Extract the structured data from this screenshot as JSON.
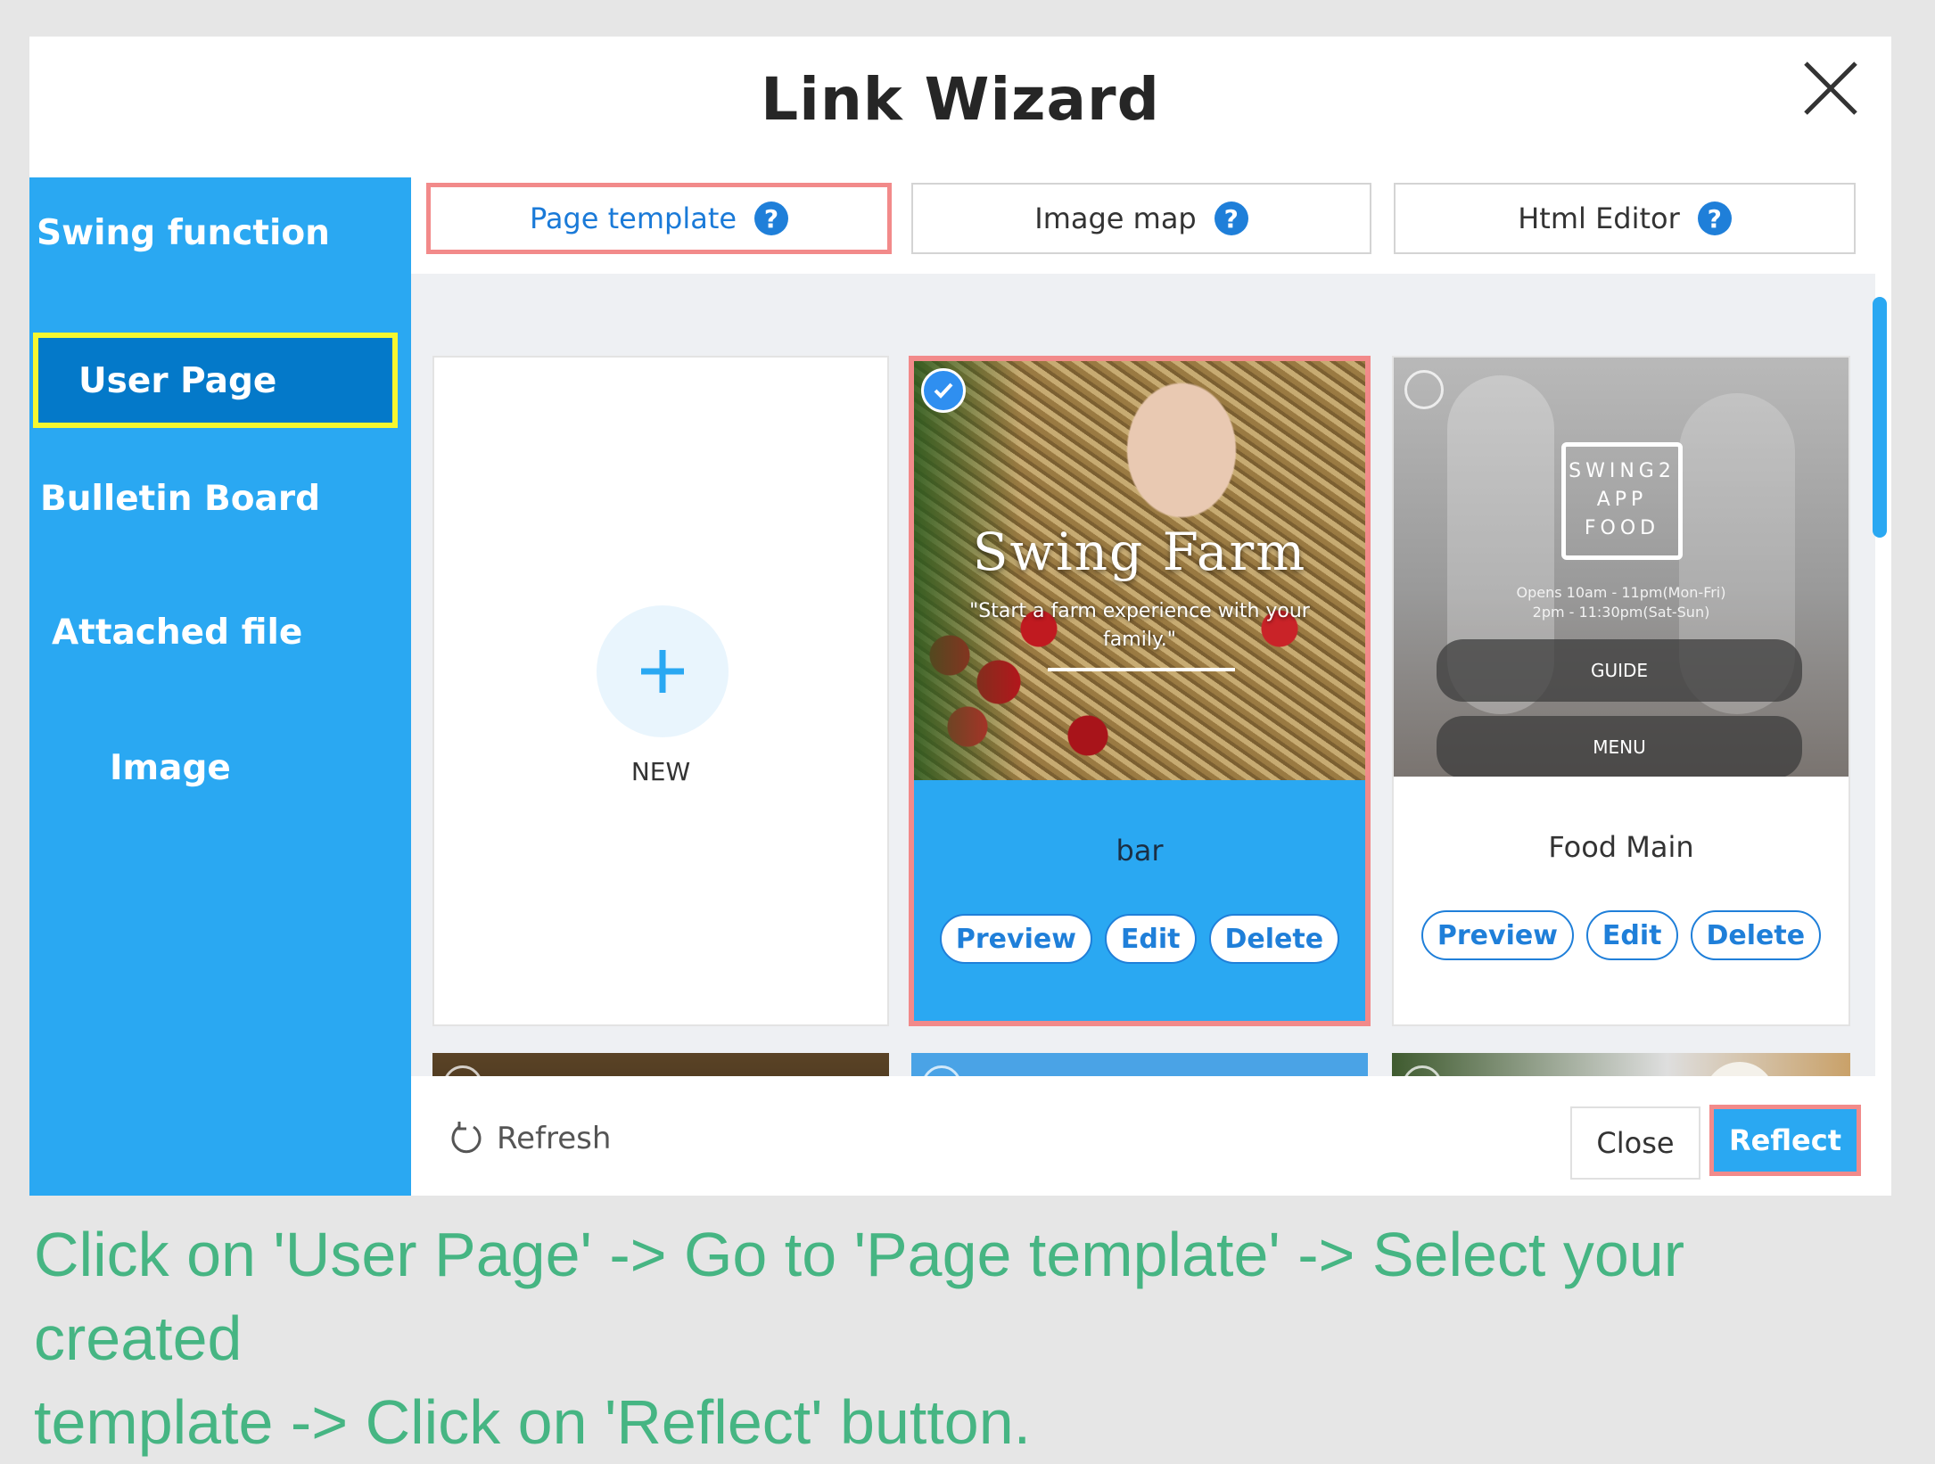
{
  "dialog": {
    "title": "Link Wizard"
  },
  "sidebar": {
    "items": [
      {
        "label": "Swing function"
      },
      {
        "label": "User Page"
      },
      {
        "label": "Bulletin Board"
      },
      {
        "label": "Attached file"
      },
      {
        "label": "Image"
      }
    ],
    "active": "User Page"
  },
  "tabs": [
    {
      "label": "Page template",
      "help": "?"
    },
    {
      "label": "Image map",
      "help": "?"
    },
    {
      "label": "Html Editor",
      "help": "?"
    }
  ],
  "templates": {
    "new_label": "NEW",
    "cards": [
      {
        "name": "bar",
        "selected": true,
        "thumb_title": "Swing Farm",
        "thumb_subtitle_1": "\"Start a farm experience with your",
        "thumb_subtitle_2": "family.\"",
        "buttons": {
          "preview": "Preview",
          "edit": "Edit",
          "delete": "Delete"
        }
      },
      {
        "name": "Food Main",
        "selected": false,
        "thumb_logo_1": "SWING2",
        "thumb_logo_2": "APP",
        "thumb_logo_3": "FOOD",
        "thumb_hours_1": "Opens 10am - 11pm(Mon-Fri)",
        "thumb_hours_2": "2pm - 11:30pm(Sat-Sun)",
        "thumb_btn_1": "GUIDE",
        "thumb_btn_2": "MENU",
        "buttons": {
          "preview": "Preview",
          "edit": "Edit",
          "delete": "Delete"
        }
      }
    ]
  },
  "footer": {
    "refresh": "Refresh",
    "close": "Close",
    "reflect": "Reflect"
  },
  "colors": {
    "sidebar": "#2aa8f2",
    "active_item": "#0479c9",
    "highlight_yellow": "#f7f72f",
    "highlight_red": "#f28a8a",
    "caption": "#46b583"
  },
  "caption": {
    "line1": "Click on 'User Page' -> Go to 'Page template' -> Select your created",
    "line2": "template -> Click on 'Reflect' button."
  }
}
